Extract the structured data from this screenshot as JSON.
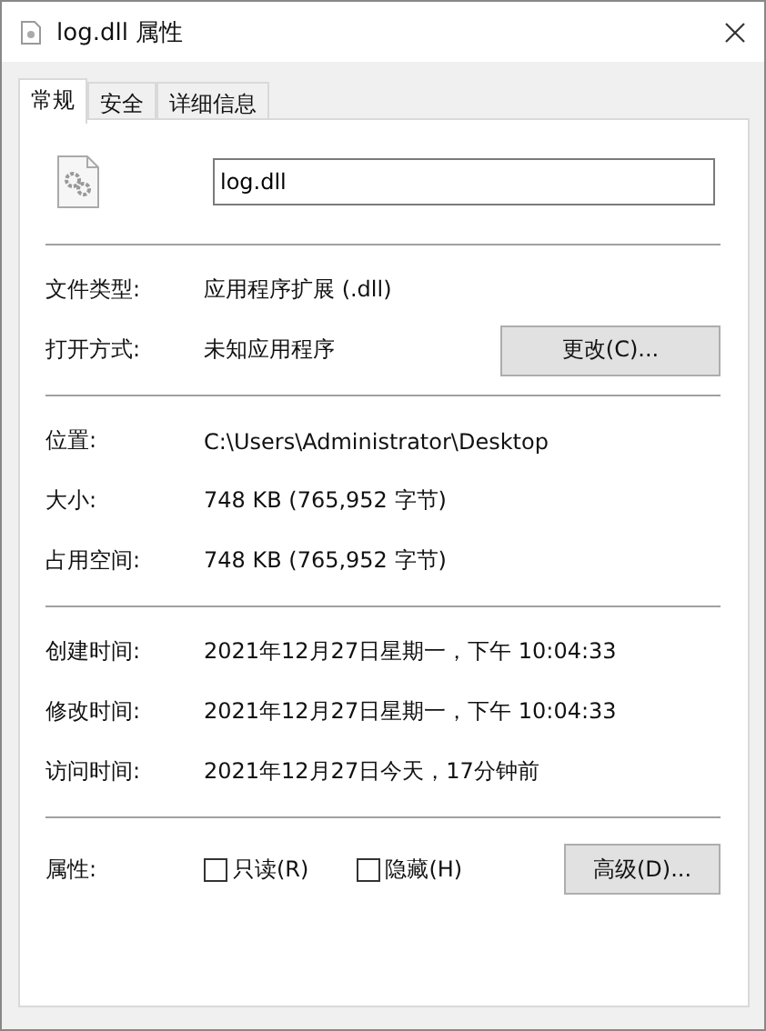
{
  "window": {
    "title": "log.dll 属性"
  },
  "tabs": [
    {
      "label": "常规",
      "selected": true
    },
    {
      "label": "安全",
      "selected": false
    },
    {
      "label": "详细信息",
      "selected": false
    }
  ],
  "file_name": {
    "value": "log.dll"
  },
  "sections": [
    [
      {
        "label": "文件类型:",
        "value": "应用程序扩展 (.dll)"
      },
      {
        "label": "打开方式:",
        "value": "未知应用程序",
        "button": "更改(C)..."
      }
    ],
    [
      {
        "label": "位置:",
        "value": "C:\\Users\\Administrator\\Desktop"
      },
      {
        "label": "大小:",
        "value": "748 KB (765,952 字节)"
      },
      {
        "label": "占用空间:",
        "value": "748 KB (765,952 字节)"
      }
    ],
    [
      {
        "label": "创建时间:",
        "value": "2021年12月27日星期一，下午 10:04:33"
      },
      {
        "label": "修改时间:",
        "value": "2021年12月27日星期一，下午 10:04:33"
      },
      {
        "label": "访问时间:",
        "value": "2021年12月27日今天，17分钟前"
      }
    ]
  ],
  "attributes": {
    "label": "属性:",
    "checkboxes": [
      {
        "label": "只读(R)",
        "checked": false
      },
      {
        "label": "隐藏(H)",
        "checked": false
      }
    ],
    "button": "高级(D)..."
  }
}
